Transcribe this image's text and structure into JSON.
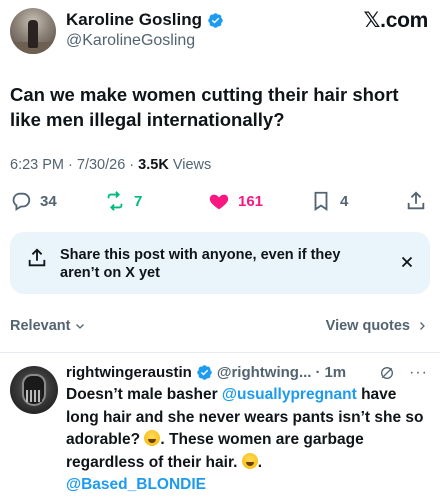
{
  "post": {
    "author_name": "Karoline Gosling",
    "author_handle": "@KarolineGosling",
    "site_label": ".com",
    "text": "Can we make women cutting their hair short like men illegal internationally?",
    "time": "6:23 PM",
    "date": "7/30/26",
    "views_count": "3.5K",
    "views_label": "Views",
    "separator": " · "
  },
  "actions": {
    "replies": "34",
    "reposts": "7",
    "likes": "161",
    "bookmarks": "4"
  },
  "share_banner": {
    "text": "Share this post with anyone, even if they aren’t on X yet"
  },
  "replies_bar": {
    "sort_label": "Relevant",
    "view_quotes_label": "View quotes"
  },
  "reply": {
    "author_name": "rightwingeraustin",
    "author_handle": "@rightwing...",
    "time": "1m",
    "body_part1": "Doesn’t male basher ",
    "mention1": "@usuallypregnant",
    "body_part2": " have long hair and she never wears pants isn’t she so adorable? ",
    "body_part3": ".  These women are garbage regardless of their hair. ",
    "body_part4": ".",
    "mention2": "@Based_BLONDIE"
  },
  "colors": {
    "accent": "#1d9bf0",
    "repost": "#00ba7c",
    "like": "#f91880",
    "muted": "#536471"
  },
  "icons": [
    "verified-badge-icon",
    "x-logo-icon",
    "reply-icon",
    "repost-icon",
    "heart-icon",
    "bookmark-icon",
    "share-icon",
    "close-icon",
    "chevron-down-icon",
    "chevron-right-icon",
    "grok-icon",
    "more-icon",
    "laughing-emoji-icon"
  ]
}
